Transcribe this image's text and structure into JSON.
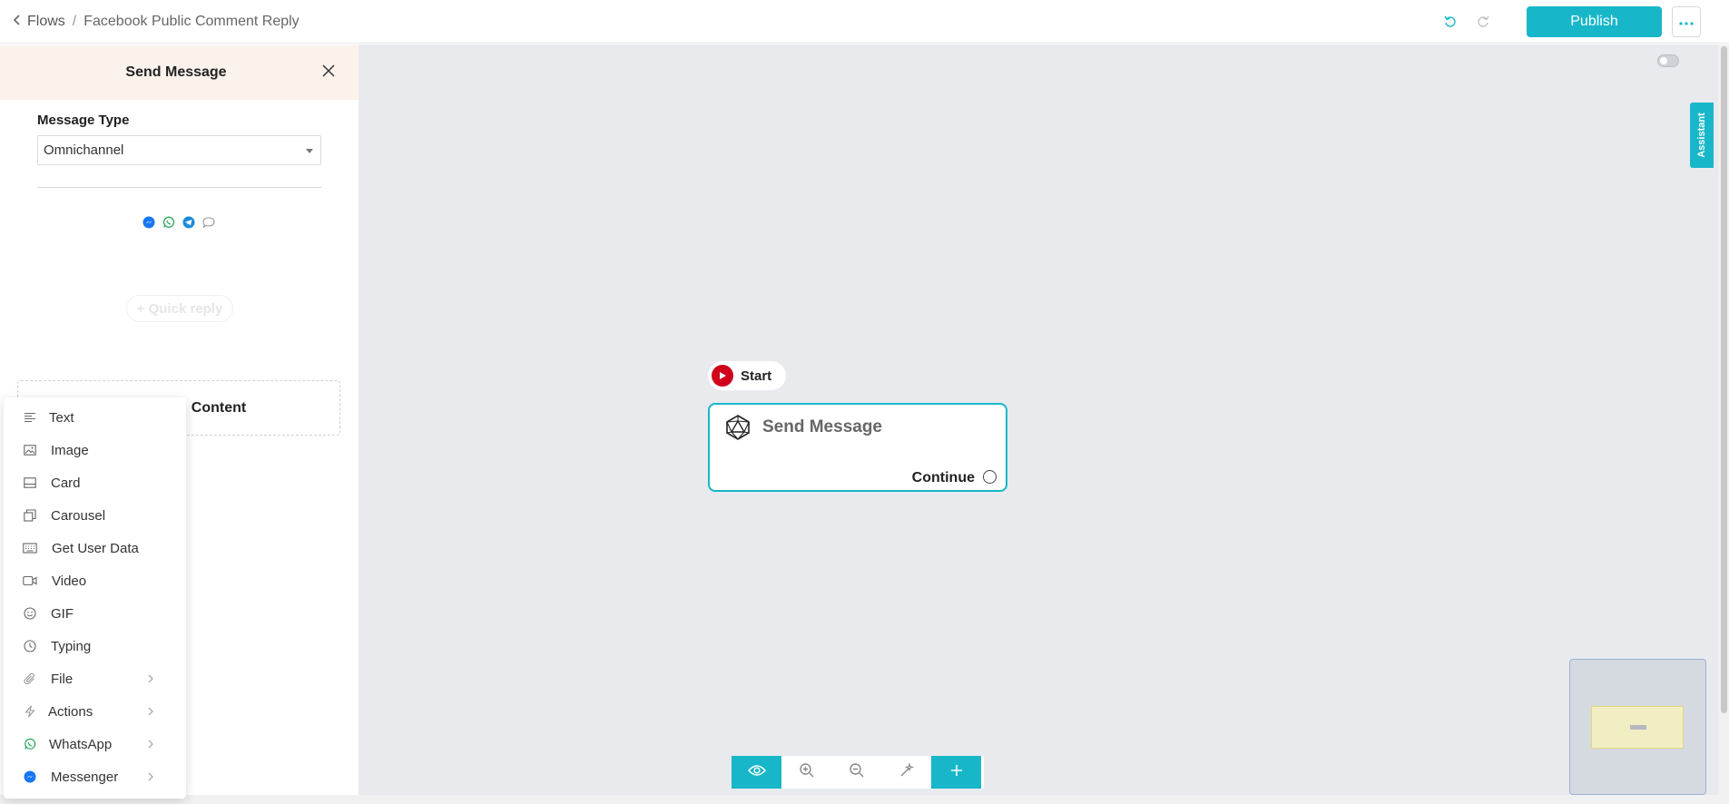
{
  "header": {
    "back_label": "Flows",
    "separator": "/",
    "flow_name": "Facebook Public Comment Reply",
    "publish_label": "Publish"
  },
  "canvas": {
    "assistant_label": "Assistant",
    "start_node": {
      "label": "Start"
    },
    "send_node": {
      "title": "Send Message",
      "continue_label": "Continue"
    }
  },
  "panel": {
    "title": "Send Message",
    "message_type_label": "Message Type",
    "message_type_value": "Omnichannel",
    "channels": [
      "messenger-icon",
      "whatsapp-icon",
      "telegram-icon",
      "livechat-icon"
    ],
    "quick_reply_label": "+ Quick reply",
    "add_content_label": "Content"
  },
  "menu": {
    "items": [
      {
        "label": "Text",
        "icon": "text-lines-icon",
        "submenu": false
      },
      {
        "label": "Image",
        "icon": "image-icon",
        "submenu": false
      },
      {
        "label": "Card",
        "icon": "card-icon",
        "submenu": false
      },
      {
        "label": "Carousel",
        "icon": "carousel-icon",
        "submenu": false
      },
      {
        "label": "Get User Data",
        "icon": "keyboard-icon",
        "submenu": false
      },
      {
        "label": "Video",
        "icon": "video-icon",
        "submenu": false
      },
      {
        "label": "GIF",
        "icon": "gif-icon",
        "submenu": false
      },
      {
        "label": "Typing",
        "icon": "clock-icon",
        "submenu": false
      },
      {
        "label": "File",
        "icon": "paperclip-icon",
        "submenu": true
      },
      {
        "label": "Actions",
        "icon": "lightning-icon",
        "submenu": true
      },
      {
        "label": "WhatsApp",
        "icon": "whatsapp-icon",
        "submenu": true
      },
      {
        "label": "Messenger",
        "icon": "messenger-icon",
        "submenu": true
      }
    ]
  },
  "colors": {
    "accent": "#17b7c9",
    "start_red": "#d0021b",
    "panel_header_bg": "#fcf2ec",
    "canvas_bg": "#e8eaee"
  }
}
